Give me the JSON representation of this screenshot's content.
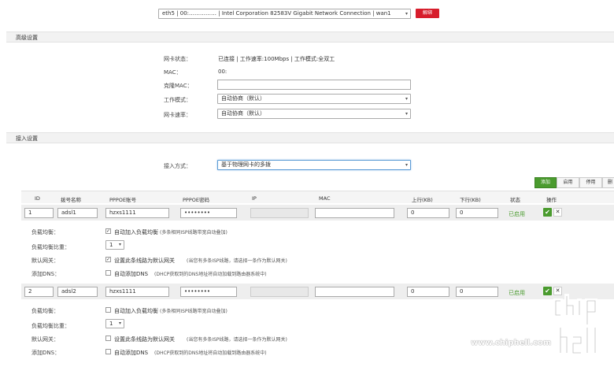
{
  "top": {
    "interface_select": "eth5 | 00:…………… | Intel Corporation 82583V Gigabit Network Connection | wan1",
    "unbind_label": "解绑"
  },
  "advanced": {
    "title": "高级设置",
    "status_label": "网卡状态：",
    "status_value": "已连接 | 工作速率:100Mbps | 工作模式:全双工",
    "mac_label": "MAC：",
    "mac_value": "00:",
    "clone_mac_label": "克隆MAC：",
    "clone_mac_value": "",
    "work_mode_label": "工作模式：",
    "work_mode_value": "自动协商（默认）",
    "speed_label": "网卡速率：",
    "speed_value": "自动协商（默认）"
  },
  "access": {
    "title": "接入设置",
    "method_label": "接入方式：",
    "method_value": "基于物理网卡的多拨"
  },
  "toolbar": {
    "add": "添加",
    "enable": "启用",
    "disable": "停用",
    "delete": "删"
  },
  "table": {
    "headers": {
      "id": "ID",
      "dial_name": "拨号名称",
      "pppoe_account": "PPPOE账号",
      "pppoe_password": "PPPOE密码",
      "ip": "IP",
      "mac": "MAC",
      "up": "上行(KB)",
      "down": "下行(KB)",
      "status": "状态",
      "ops": "操作"
    },
    "rows": [
      {
        "id": "1",
        "name": "adsl1",
        "account": "hzxs1111",
        "password": "••••••••",
        "ip": "",
        "mac": "",
        "up": "0",
        "down": "0",
        "status": "已启用",
        "lb_label": "负载均衡：",
        "lb_text": "自动加入负载均衡",
        "lb_note": "(多条相同ISP线路带宽自动叠加)",
        "weight_label": "负载均衡比重：",
        "weight_value": "1",
        "gw_label": "默认网关：",
        "gw_text": "设置此条线路为默认网关",
        "gw_note": "(当您有多条ISP线路，请选择一条作为默认网关)",
        "dns_label": "添加DNS：",
        "dns_text": "自动添加DNS",
        "dns_note": "(DHCP获取到的DNS地址将自动加载到路由器系统中)"
      },
      {
        "id": "2",
        "name": "adsl2",
        "account": "hzxs1111",
        "password": "••••••••",
        "ip": "",
        "mac": "",
        "up": "0",
        "down": "0",
        "status": "已启用",
        "lb_label": "负载均衡：",
        "lb_text": "自动加入负载均衡",
        "lb_note": "(多条相同ISP线路带宽自动叠加)",
        "weight_label": "负载均衡比重：",
        "weight_value": "1",
        "gw_label": "默认网关：",
        "gw_text": "设置此条线路为默认网关",
        "gw_note": "(当您有多条ISP线路，请选择一条作为默认网关)",
        "dns_label": "添加DNS：",
        "dns_text": "自动添加DNS",
        "dns_note": "(DHCP获取到的DNS地址将自动加载到路由器系统中)"
      }
    ]
  },
  "watermark": {
    "url": "www.chiphell.com"
  },
  "colors": {
    "accent_red": "#d71d2b",
    "accent_green": "#4a9b2e",
    "focus_blue": "#5b9bd5"
  }
}
